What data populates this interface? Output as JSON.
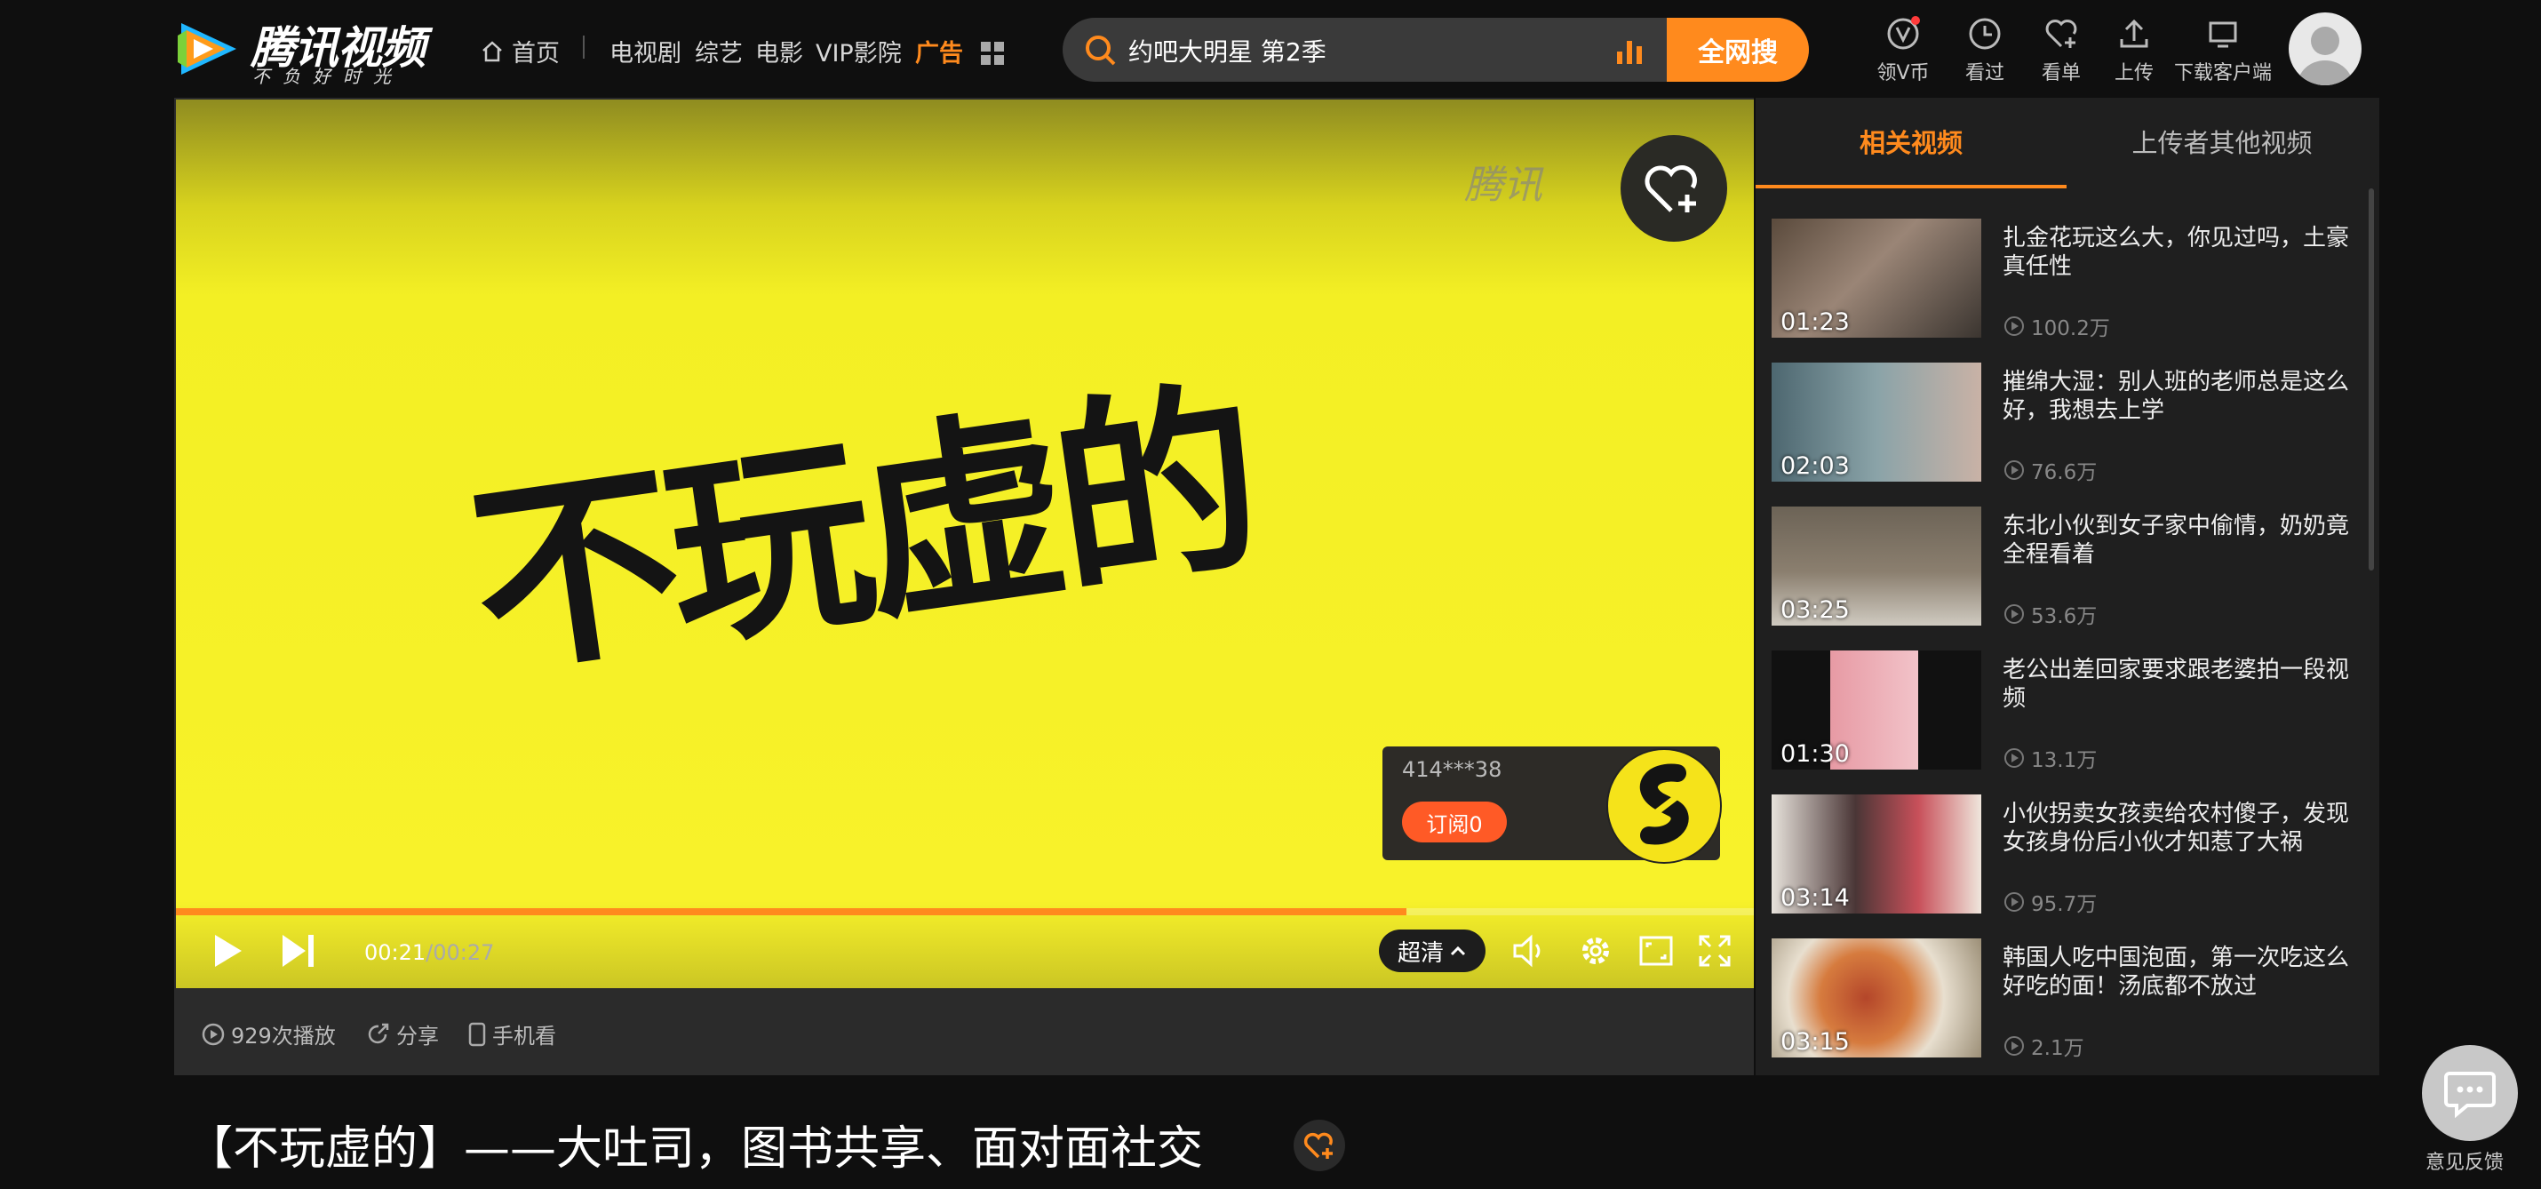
{
  "header": {
    "logo_text": "腾讯视频",
    "logo_slogan": "不负好时光",
    "nav": {
      "home": "首页",
      "items": [
        "电视剧",
        "综艺",
        "电影",
        "VIP影院"
      ],
      "ad": "广告"
    },
    "search": {
      "value": "约吧大明星 第2季",
      "button": "全网搜"
    },
    "actions": {
      "vcoin": "领V币",
      "history": "看过",
      "watchlist": "看单",
      "upload": "上传",
      "client": "下载客户端"
    }
  },
  "player": {
    "video_text": "不玩虚的",
    "watermark": "腾讯",
    "uploader": {
      "name": "414***38",
      "subscribe": "订阅0"
    },
    "progress": 0.78,
    "time_current": "00:21",
    "time_sep": "/",
    "time_total": "00:27",
    "quality": "超清"
  },
  "info_bar": {
    "plays": "929次播放",
    "share": "分享",
    "mobile": "手机看"
  },
  "sidebar": {
    "tabs": [
      "相关视频",
      "上传者其他视频"
    ],
    "items": [
      {
        "title": "扎金花玩这么大，你见过吗，土豪真任性",
        "duration": "01:23",
        "views": "100.2万"
      },
      {
        "title": "摧绵大湿：别人班的老师总是这么好，我想去上学",
        "duration": "02:03",
        "views": "76.6万"
      },
      {
        "title": "东北小伙到女子家中偷情，奶奶竟全程看着",
        "duration": "03:25",
        "views": "53.6万"
      },
      {
        "title": "老公出差回家要求跟老婆拍一段视频",
        "duration": "01:30",
        "views": "13.1万"
      },
      {
        "title": "小伙拐卖女孩卖给农村傻子，发现女孩身份后小伙才知惹了大祸",
        "duration": "03:14",
        "views": "95.7万"
      },
      {
        "title": "韩国人吃中国泡面，第一次吃这么好吃的面！汤底都不放过",
        "duration": "03:15",
        "views": "2.1万"
      }
    ]
  },
  "page_title": "【不玩虚的】——大吐司，图书共享、面对面社交",
  "feedback": "意见反馈",
  "colors": {
    "accent": "#ff8a1d",
    "subscribe": "#ff5a26",
    "video_bg": "#f8f22a"
  }
}
